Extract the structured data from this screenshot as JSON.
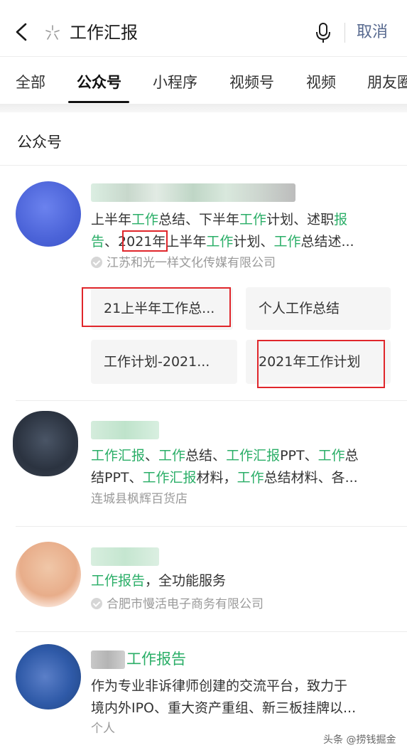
{
  "search": {
    "query": "工作汇报",
    "cancel_label": "取消"
  },
  "tabs": [
    {
      "label": "全部",
      "active": false
    },
    {
      "label": "公众号",
      "active": true
    },
    {
      "label": "小程序",
      "active": false
    },
    {
      "label": "视频号",
      "active": false
    },
    {
      "label": "视频",
      "active": false
    },
    {
      "label": "朋友圈",
      "active": false
    }
  ],
  "section": {
    "title": "公众号"
  },
  "results": [
    {
      "desc_line1": [
        "上半年",
        "工作",
        "总结、下半年",
        "工作",
        "计划、述职",
        "报"
      ],
      "desc_line2": [
        "告",
        "、",
        "2021",
        "年上半年",
        "工作",
        "计划、",
        "工作",
        "总结述..."
      ],
      "source": "江苏和光一样文化传媒有限公司",
      "verified": true,
      "chips": [
        "21上半年工作总...",
        "个人工作总结",
        "工作计划-2021...",
        "2021年工作计划"
      ]
    },
    {
      "desc_line1": [
        "工作汇报",
        "、",
        "工作",
        "总结、",
        "工作汇报",
        "PPT、",
        "工作",
        "总"
      ],
      "desc_line2": [
        "结PPT、",
        "工作汇报",
        "材料，",
        "工作",
        "总结材料、各..."
      ],
      "source": "连城县枫辉百货店",
      "verified": false
    },
    {
      "desc_line1": [
        "工作报告",
        "，全功能服务"
      ],
      "source": "合肥市慢活电子商务有限公司",
      "verified": true
    },
    {
      "name_suffix": "工作报告",
      "desc_line1": "作为专业非诉律师创建的交流平台，致力于",
      "desc_line2": "境内外IPO、重大资产重组、新三板挂牌以...",
      "source": "个人"
    }
  ],
  "watermark": "头条 @捞钱掘金",
  "colors": {
    "highlight": "#2aae67",
    "cancel": "#57698f",
    "annotation": "#e0262b"
  }
}
